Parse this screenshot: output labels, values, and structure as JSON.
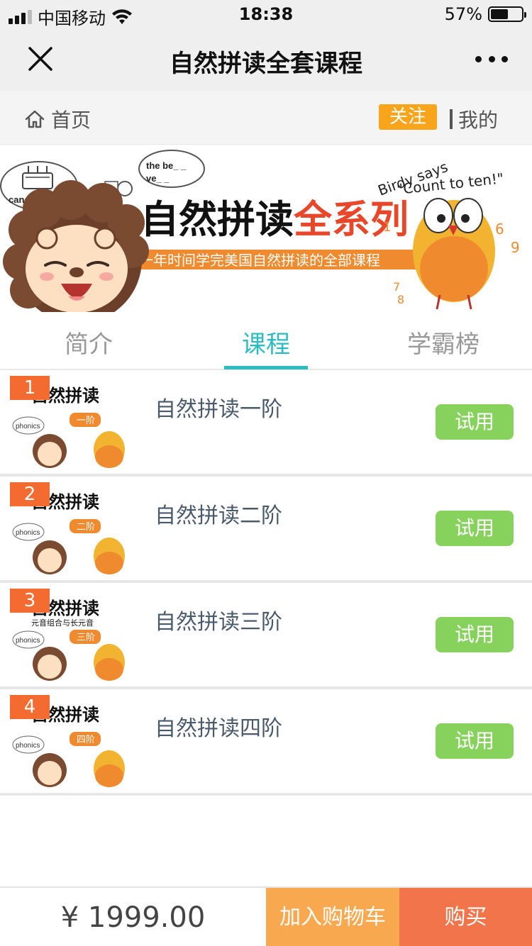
{
  "status_bar": {
    "carrier": "中国移动",
    "time": "18:38",
    "battery": "57%",
    "battery_level": 0.57
  },
  "nav": {
    "title": "自然拼读全套课程",
    "close_icon": "close-icon",
    "more_icon": "more-dots-icon"
  },
  "subnav": {
    "home_label": "首页",
    "follow_label": "关注",
    "mine_label": "我的"
  },
  "banner": {
    "title_black": "自然拼读",
    "title_orange": "全系列",
    "subtitle": "一年时间学完美国自然拼读的全部课程",
    "bubble_left": "candles burning",
    "bubble_mid_line1": "the be_ _",
    "bubble_mid_line2": "ve_ _",
    "birdy_line1": "Birdy says",
    "birdy_line2": "\"Count to ten!\"",
    "numbers": [
      "1",
      "6",
      "9",
      "7",
      "8"
    ]
  },
  "tabs": [
    {
      "label": "简介",
      "active": false
    },
    {
      "label": "课程",
      "active": true
    },
    {
      "label": "学霸榜",
      "active": false
    }
  ],
  "courses": [
    {
      "index": "1",
      "title": "自然拼读一阶",
      "thumb_title": "自然拼读",
      "thumb_tag": "一阶",
      "thumb_sub": "",
      "thumb_word": "phonics",
      "action": "试用"
    },
    {
      "index": "2",
      "title": "自然拼读二阶",
      "thumb_title": "自然拼读",
      "thumb_tag": "二阶",
      "thumb_sub": "",
      "thumb_word": "phonics",
      "action": "试用"
    },
    {
      "index": "3",
      "title": "自然拼读三阶",
      "thumb_title": "自然拼读",
      "thumb_tag": "三阶",
      "thumb_sub": "元音组合与长元音",
      "thumb_word": "phonics",
      "action": "试用"
    },
    {
      "index": "4",
      "title": "自然拼读四阶",
      "thumb_title": "自然拼读",
      "thumb_tag": "四阶",
      "thumb_sub": "",
      "thumb_word": "phonics",
      "action": "试用"
    }
  ],
  "bottom": {
    "price": "¥ 1999.00",
    "add_to_cart": "加入购物车",
    "buy": "购买"
  },
  "colors": {
    "accent_teal": "#2bbcc2",
    "follow_orange": "#f8a51c",
    "try_green": "#86d25d",
    "cart_orange": "#f8a84f",
    "buy_red": "#f2744a",
    "badge_orange": "#f36b30"
  }
}
